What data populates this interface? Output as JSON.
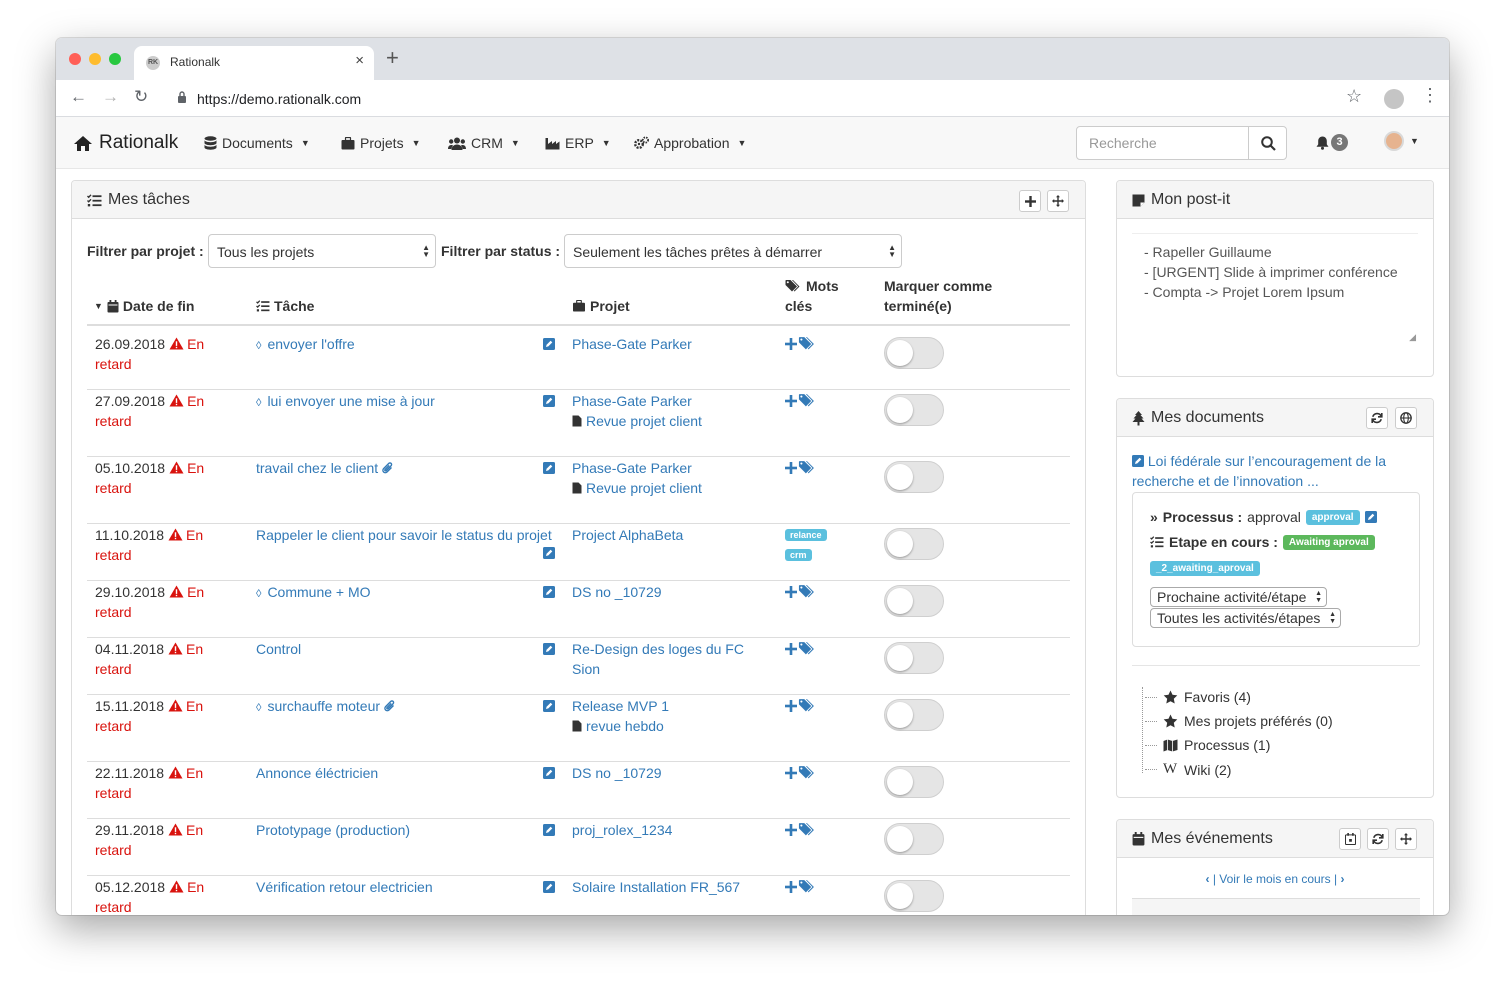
{
  "browser": {
    "tab_title": "Rationalk",
    "favicon_text": "RK",
    "url": "https://demo.rationalk.com"
  },
  "navbar": {
    "brand": "Rationalk",
    "menus": [
      "Documents",
      "Projets",
      "CRM",
      "ERP",
      "Approbation"
    ],
    "search_placeholder": "Recherche",
    "notification_count": "3"
  },
  "tasks": {
    "title": "Mes tâches",
    "filter_project_label": "Filtrer par projet :",
    "filter_project_value": "Tous les projets",
    "filter_status_label": "Filtrer par status :",
    "filter_status_value": "Seulement les tâches prêtes à démarrer",
    "headers": {
      "due": "Date de fin",
      "task": "Tâche",
      "project": "Projet",
      "keywords_1": "Mots",
      "keywords_2": "clés",
      "done_1": "Marquer comme",
      "done_2": "terminé(e)"
    },
    "late_1": "En",
    "late_2": "retard",
    "rows": [
      {
        "date": "26.09.2018",
        "task": "envoyer l'offre",
        "task_icon": "diamond",
        "project": "Phase-Gate Parker",
        "subproject": ""
      },
      {
        "date": "27.09.2018",
        "task": "lui envoyer une mise à jour",
        "task_icon": "diamond",
        "project": "Phase-Gate Parker",
        "subproject": "Revue projet client"
      },
      {
        "date": "05.10.2018",
        "task": "travail chez le client",
        "task_icon": "paperclip",
        "project": "Phase-Gate Parker",
        "subproject": "Revue projet client"
      },
      {
        "date": "11.10.2018",
        "task": "Rappeler le client pour savoir le status du projet",
        "task_icon": "",
        "project": "Project AlphaBeta",
        "subproject": "",
        "tags": [
          "relance",
          "crm"
        ]
      },
      {
        "date": "29.10.2018",
        "task": "Commune + MO",
        "task_icon": "diamond",
        "project": "DS no _10729",
        "subproject": ""
      },
      {
        "date": "04.11.2018",
        "task": "Control",
        "task_icon": "",
        "project": "Re-Design des loges du FC",
        "project_2": "Sion",
        "subproject": ""
      },
      {
        "date": "15.11.2018",
        "task": "surchauffe moteur",
        "task_icon": "diamond-paperclip",
        "project": "Release MVP 1",
        "subproject": "revue hebdo"
      },
      {
        "date": "22.11.2018",
        "task": "Annonce éléctricien",
        "task_icon": "",
        "project": "DS no _10729",
        "subproject": ""
      },
      {
        "date": "29.11.2018",
        "task": "Prototypage (production)",
        "task_icon": "",
        "project": "proj_rolex_1234",
        "subproject": ""
      },
      {
        "date": "05.12.2018",
        "task": "Vérification retour electricien",
        "task_icon": "",
        "project": "Solaire Installation FR_567",
        "subproject": ""
      }
    ]
  },
  "postit": {
    "title": "Mon post-it",
    "lines": [
      "- Rapeller Guillaume",
      "- [URGENT] Slide à imprimer conférence",
      "- Compta -> Projet Lorem Ipsum"
    ]
  },
  "documents": {
    "title": "Mes documents",
    "doc_link_1": "Loi fédérale sur l’encouragement de la",
    "doc_link_2": "recherche et de l’innovation ...",
    "process_label": "Processus :",
    "process_value": "approval",
    "process_badge": "approval",
    "step_label": "Etape en cours :",
    "step_badge": "Awaiting aproval",
    "step_id_badge": "_2_awaiting_aproval",
    "next_select": "Prochaine activité/étape",
    "all_select": "Toutes les activités/étapes",
    "tree": [
      "Favoris (4)",
      "Mes projets préférés (0)",
      "Processus (1)",
      "Wiki (2)"
    ]
  },
  "events": {
    "title": "Mes événements",
    "nav_text": "| Voir le mois en cours |"
  },
  "colors": {
    "link": "#337ab7",
    "late": "#d9130e",
    "info": "#5bc0de",
    "success": "#5cb85c"
  }
}
